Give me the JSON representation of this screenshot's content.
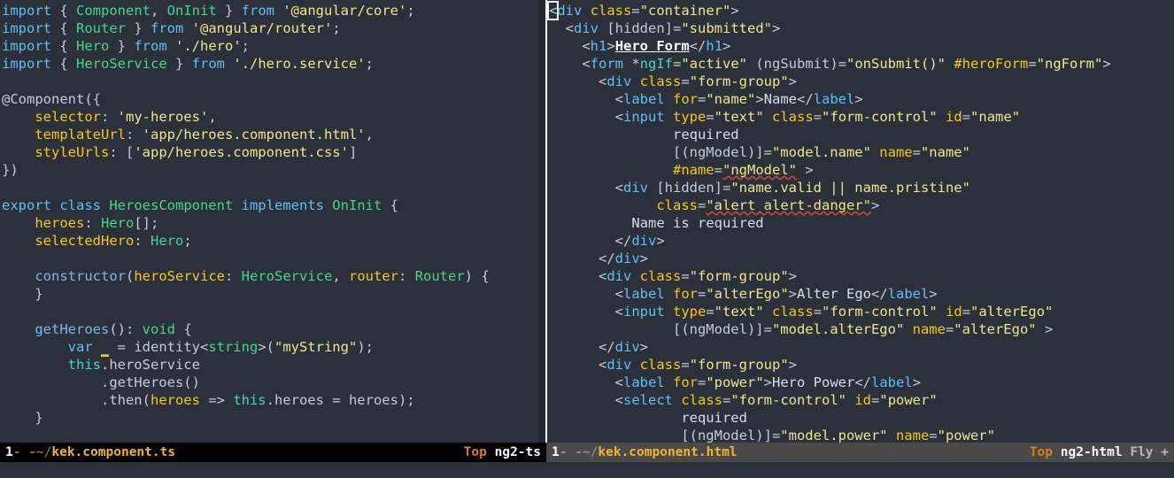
{
  "editor": {
    "theme_bg": "#2b303b",
    "divider_bg": "#21252d",
    "cursor_color": "#ffffff"
  },
  "panes": [
    {
      "id": "left",
      "active": true,
      "buffer_name": "kek.component.ts",
      "language": "typescript",
      "modeline": {
        "window_number": "1",
        "modified_flags": "-  -~/",
        "file_path": "~/kek.component.ts",
        "file_label": "kek.component.ts",
        "position": "Top",
        "major_mode": "ng2-ts",
        "minor_modes": ""
      },
      "lines": [
        "import { Component, OnInit } from '@angular/core';",
        "import { Router } from '@angular/router';",
        "import { Hero } from './hero';",
        "import { HeroService } from './hero.service';",
        "",
        "@Component({",
        "    selector: 'my-heroes',",
        "    templateUrl: 'app/heroes.component.html',",
        "    styleUrls: ['app/heroes.component.css']",
        "})",
        "",
        "export class HeroesComponent implements OnInit {",
        "    heroes: Hero[];",
        "    selectedHero: Hero;",
        "",
        "    constructor(heroService: HeroService, router: Router) {",
        "    }",
        "",
        "    getHeroes(): void {",
        "        var _ = identity<string>(\"myString\");",
        "        this.heroService",
        "            .getHeroes()",
        "            .then(heroes => this.heroes = heroes);",
        "    }"
      ]
    },
    {
      "id": "right",
      "active": false,
      "buffer_name": "kek.component.html",
      "language": "html",
      "cursor": {
        "line": 1,
        "column": 1,
        "char": "<"
      },
      "modeline": {
        "window_number": "1",
        "modified_flags": "-  -~/",
        "file_path": "~/kek.component.html",
        "file_label": "kek.component.html",
        "position": "Top",
        "major_mode": "ng2-html",
        "minor_modes": "Fly +"
      },
      "lines": [
        "<div class=\"container\">",
        "  <div [hidden]=\"submitted\">",
        "    <h1>Hero Form</h1>",
        "    <form *ngIf=\"active\" (ngSubmit)=\"onSubmit()\" #heroForm=\"ngForm\">",
        "      <div class=\"form-group\">",
        "        <label for=\"name\">Name</label>",
        "        <input type=\"text\" class=\"form-control\" id=\"name\"",
        "               required",
        "               [(ngModel)]=\"model.name\" name=\"name\"",
        "               #name=\"ngModel\" >",
        "        <div [hidden]=\"name.valid || name.pristine\"",
        "             class=\"alert alert-danger\">",
        "          Name is required",
        "        </div>",
        "      </div>",
        "      <div class=\"form-group\">",
        "        <label for=\"alterEgo\">Alter Ego</label>",
        "        <input type=\"text\" class=\"form-control\" id=\"alterEgo\"",
        "               [(ngModel)]=\"model.alterEgo\" name=\"alterEgo\" >",
        "      </div>",
        "      <div class=\"form-group\">",
        "        <label for=\"power\">Hero Power</label>",
        "        <select class=\"form-control\" id=\"power\"",
        "                required",
        "                [(ngModel)]=\"model.power\" name=\"power\""
      ]
    }
  ],
  "tokens": {
    "left": [
      [
        [
          "import ",
          "t-kw"
        ],
        [
          "{ ",
          "t-punc"
        ],
        [
          "Component",
          "t-type"
        ],
        [
          ", ",
          "t-punc"
        ],
        [
          "OnInit",
          "t-type"
        ],
        [
          " } ",
          "t-punc"
        ],
        [
          "from ",
          "t-kw"
        ],
        [
          "'@angular/core'",
          "t-str"
        ],
        [
          ";",
          "t-punc"
        ]
      ],
      [
        [
          "import ",
          "t-kw"
        ],
        [
          "{ ",
          "t-punc"
        ],
        [
          "Router",
          "t-type"
        ],
        [
          " } ",
          "t-punc"
        ],
        [
          "from ",
          "t-kw"
        ],
        [
          "'@angular/router'",
          "t-str"
        ],
        [
          ";",
          "t-punc"
        ]
      ],
      [
        [
          "import ",
          "t-kw"
        ],
        [
          "{ ",
          "t-punc"
        ],
        [
          "Hero",
          "t-type"
        ],
        [
          " } ",
          "t-punc"
        ],
        [
          "from ",
          "t-kw"
        ],
        [
          "'./hero'",
          "t-str"
        ],
        [
          ";",
          "t-punc"
        ]
      ],
      [
        [
          "import ",
          "t-kw"
        ],
        [
          "{ ",
          "t-punc"
        ],
        [
          "HeroService",
          "t-type"
        ],
        [
          " } ",
          "t-punc"
        ],
        [
          "from ",
          "t-kw"
        ],
        [
          "'./hero.service'",
          "t-str"
        ],
        [
          ";",
          "t-punc"
        ]
      ],
      [],
      [
        [
          "@Component({",
          "t-plain"
        ]
      ],
      [
        [
          "    ",
          "t-plain"
        ],
        [
          "selector",
          "t-prop"
        ],
        [
          ": ",
          "t-punc"
        ],
        [
          "'my-heroes'",
          "t-str"
        ],
        [
          ",",
          "t-punc"
        ]
      ],
      [
        [
          "    ",
          "t-plain"
        ],
        [
          "templateUrl",
          "t-prop"
        ],
        [
          ": ",
          "t-punc"
        ],
        [
          "'app/heroes.component.html'",
          "t-str"
        ],
        [
          ",",
          "t-punc"
        ]
      ],
      [
        [
          "    ",
          "t-plain"
        ],
        [
          "styleUrls",
          "t-prop"
        ],
        [
          ": [",
          "t-punc"
        ],
        [
          "'app/heroes.component.css'",
          "t-str"
        ],
        [
          "]",
          "t-punc"
        ]
      ],
      [
        [
          "})",
          "t-plain"
        ]
      ],
      [],
      [
        [
          "export ",
          "t-kw"
        ],
        [
          "class ",
          "t-kw"
        ],
        [
          "HeroesComponent ",
          "t-type"
        ],
        [
          "implements ",
          "t-kw"
        ],
        [
          "OnInit",
          "t-type"
        ],
        [
          " {",
          "t-punc"
        ]
      ],
      [
        [
          "    ",
          "t-plain"
        ],
        [
          "heroes",
          "t-prop"
        ],
        [
          ": ",
          "t-punc"
        ],
        [
          "Hero",
          "t-type"
        ],
        [
          "[];",
          "t-punc"
        ]
      ],
      [
        [
          "    ",
          "t-plain"
        ],
        [
          "selectedHero",
          "t-prop"
        ],
        [
          ": ",
          "t-punc"
        ],
        [
          "Hero",
          "t-type"
        ],
        [
          ";",
          "t-punc"
        ]
      ],
      [],
      [
        [
          "    ",
          "t-plain"
        ],
        [
          "constructor",
          "t-fn"
        ],
        [
          "(",
          "t-punc"
        ],
        [
          "heroService",
          "t-prop"
        ],
        [
          ": ",
          "t-punc"
        ],
        [
          "HeroService",
          "t-type"
        ],
        [
          ", ",
          "t-punc"
        ],
        [
          "router",
          "t-prop"
        ],
        [
          ": ",
          "t-punc"
        ],
        [
          "Router",
          "t-type"
        ],
        [
          ") {",
          "t-punc"
        ]
      ],
      [
        [
          "    }",
          "t-punc"
        ]
      ],
      [],
      [
        [
          "    ",
          "t-plain"
        ],
        [
          "getHeroes",
          "t-fn"
        ],
        [
          "(): ",
          "t-punc"
        ],
        [
          "void",
          "t-type"
        ],
        [
          " {",
          "t-punc"
        ]
      ],
      [
        [
          "        ",
          "t-plain"
        ],
        [
          "var ",
          "t-kw"
        ],
        [
          "_",
          "uline-y t-plain"
        ],
        [
          " = identity<",
          "t-plain"
        ],
        [
          "string",
          "t-type"
        ],
        [
          ">(",
          "t-plain"
        ],
        [
          "\"myString\"",
          "t-str"
        ],
        [
          ");",
          "t-punc"
        ]
      ],
      [
        [
          "        ",
          "t-plain"
        ],
        [
          "this",
          "t-this"
        ],
        [
          ".heroService",
          "t-plain"
        ]
      ],
      [
        [
          "            .getHeroes()",
          "t-plain"
        ]
      ],
      [
        [
          "            .then(",
          "t-plain"
        ],
        [
          "heroes",
          "t-prop"
        ],
        [
          " => ",
          "t-plain"
        ],
        [
          "this",
          "t-this"
        ],
        [
          ".heroes = heroes);",
          "t-plain"
        ]
      ],
      [
        [
          "    }",
          "t-punc"
        ]
      ]
    ]
  },
  "colors": {
    "background": "#2b303b",
    "foreground": "#c0c5ce",
    "keyword": "#5dc2f2",
    "type": "#3fd88f",
    "string": "#f0e68c",
    "property": "#f7c815",
    "function": "#7fb7e8",
    "this": "#3fd8c8",
    "modeline_active_bg": "#000000",
    "modeline_inactive_bg": "#4a4a4a",
    "modeline_file": "#f7b32b",
    "modeline_position": "#e07b20",
    "spellcheck_underline": "#d04a3a"
  }
}
